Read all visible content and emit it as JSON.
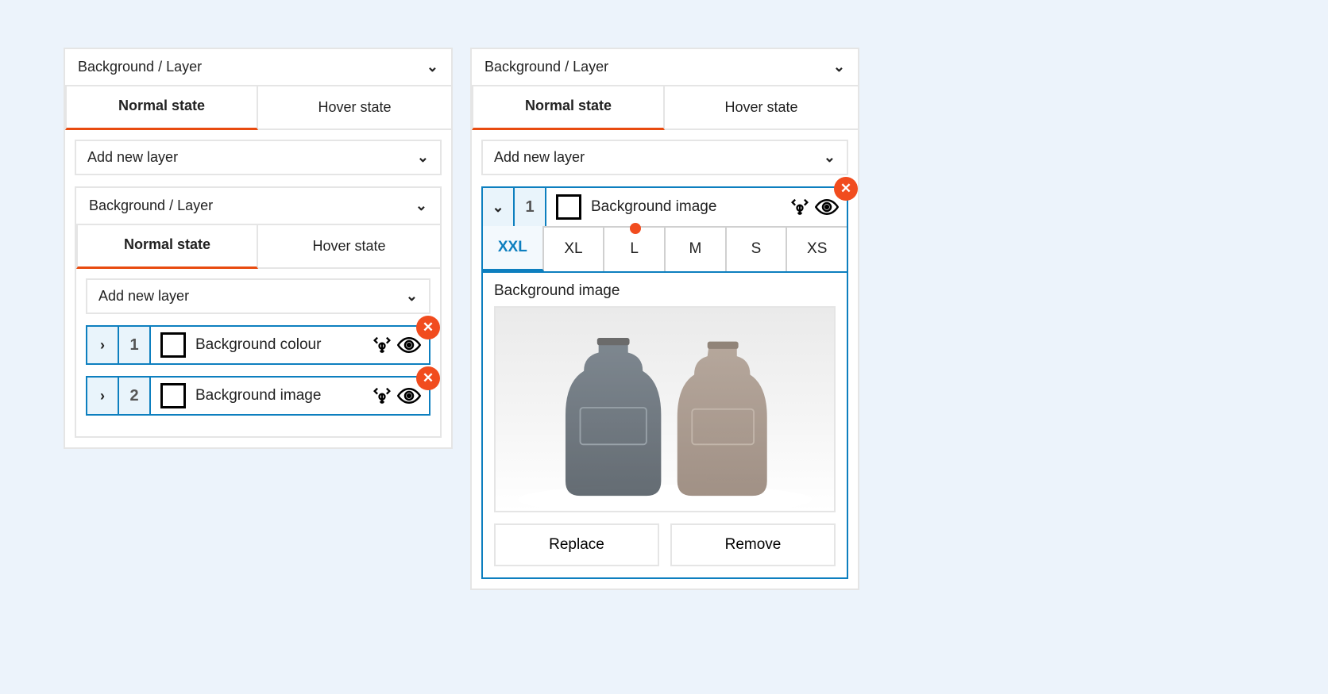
{
  "left": {
    "section1": {
      "title": "Background / Layer"
    },
    "tabs": {
      "normal": "Normal state",
      "hover": "Hover state"
    },
    "addLayer": "Add new layer",
    "section2": {
      "title": "Background / Layer"
    },
    "layers": [
      {
        "num": "1",
        "label": "Background colour"
      },
      {
        "num": "2",
        "label": "Background image"
      }
    ]
  },
  "right": {
    "section": {
      "title": "Background / Layer"
    },
    "tabs": {
      "normal": "Normal state",
      "hover": "Hover state"
    },
    "addLayer": "Add new layer",
    "layer": {
      "num": "1",
      "label": "Background image"
    },
    "sizes": [
      "XXL",
      "XL",
      "L",
      "M",
      "S",
      "XS"
    ],
    "activeSize": "XXL",
    "dotIndex": 2,
    "detailTitle": "Background image",
    "replace": "Replace",
    "remove": "Remove"
  }
}
